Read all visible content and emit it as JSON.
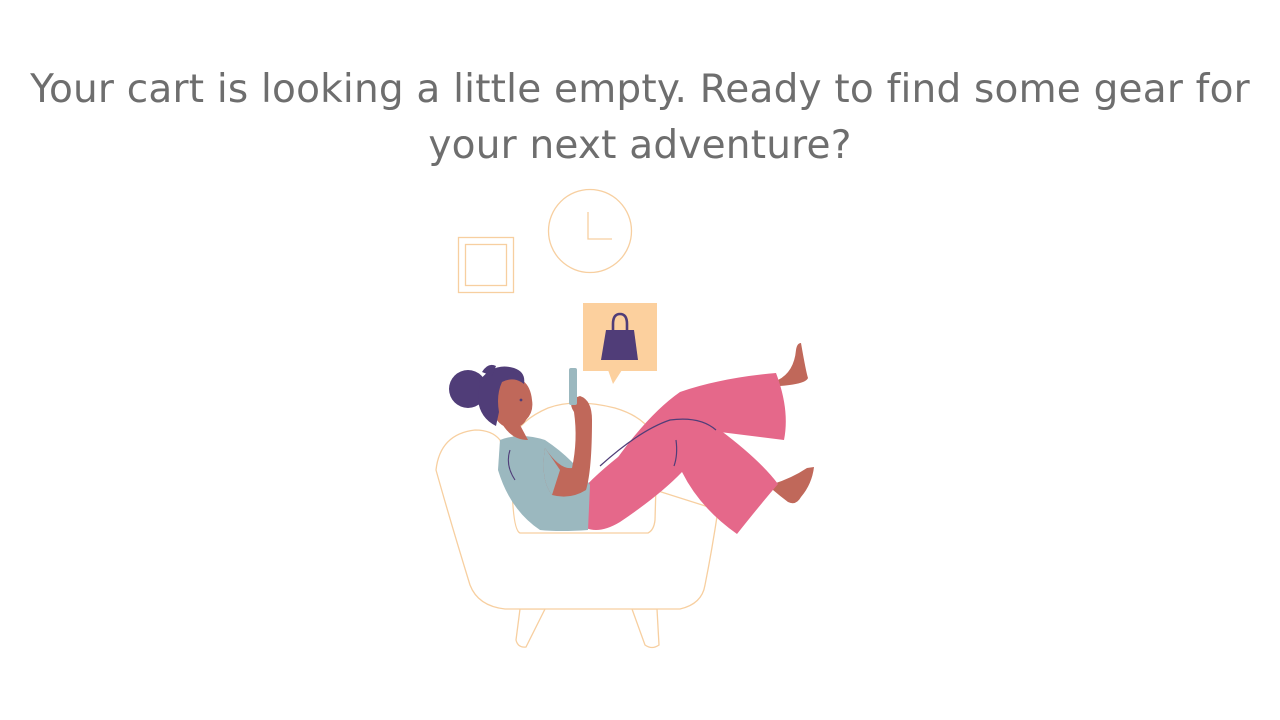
{
  "empty_cart": {
    "message_line_1": "Your cart is looking a little empty. Ready to find some gear for",
    "message_line_2": "your next adventure?"
  },
  "colors": {
    "text": "#6e6e6e",
    "outline": "#f7cfa0",
    "hair": "#503d78",
    "skin": "#c0685a",
    "shirt": "#9bb8bf",
    "pants": "#e5688a",
    "bubble": "#fcd09e",
    "bag": "#503d78",
    "phone": "#9bb8bf"
  },
  "icons": {
    "frame": "picture-frame-icon",
    "clock": "clock-icon",
    "bag": "shopping-bag-icon"
  }
}
